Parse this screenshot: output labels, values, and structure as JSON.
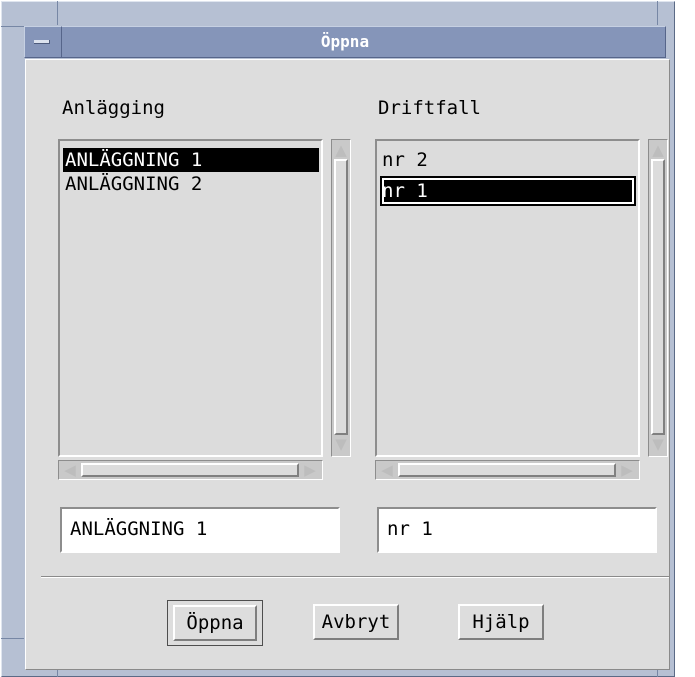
{
  "window": {
    "title": "Öppna"
  },
  "left": {
    "label": "Anlägging",
    "items": [
      "ANLÄGGNING 1",
      "ANLÄGGNING 2"
    ],
    "selected_value": "ANLÄGGNING 1"
  },
  "right": {
    "label": "Driftfall",
    "items": [
      "nr 2",
      "nr 1"
    ],
    "selected_value": "nr 1"
  },
  "buttons": {
    "open": "Öppna",
    "cancel": "Avbryt",
    "help": "Hjälp"
  },
  "icons": {
    "window_menu": "window-menu-icon",
    "arrow_up": "▲",
    "arrow_down": "▼",
    "arrow_left": "◀",
    "arrow_right": "▶"
  },
  "colors": {
    "titlebar": "#8595b9",
    "frame": "#b6c0d3",
    "client": "#dddddd",
    "selection": "#000000"
  }
}
